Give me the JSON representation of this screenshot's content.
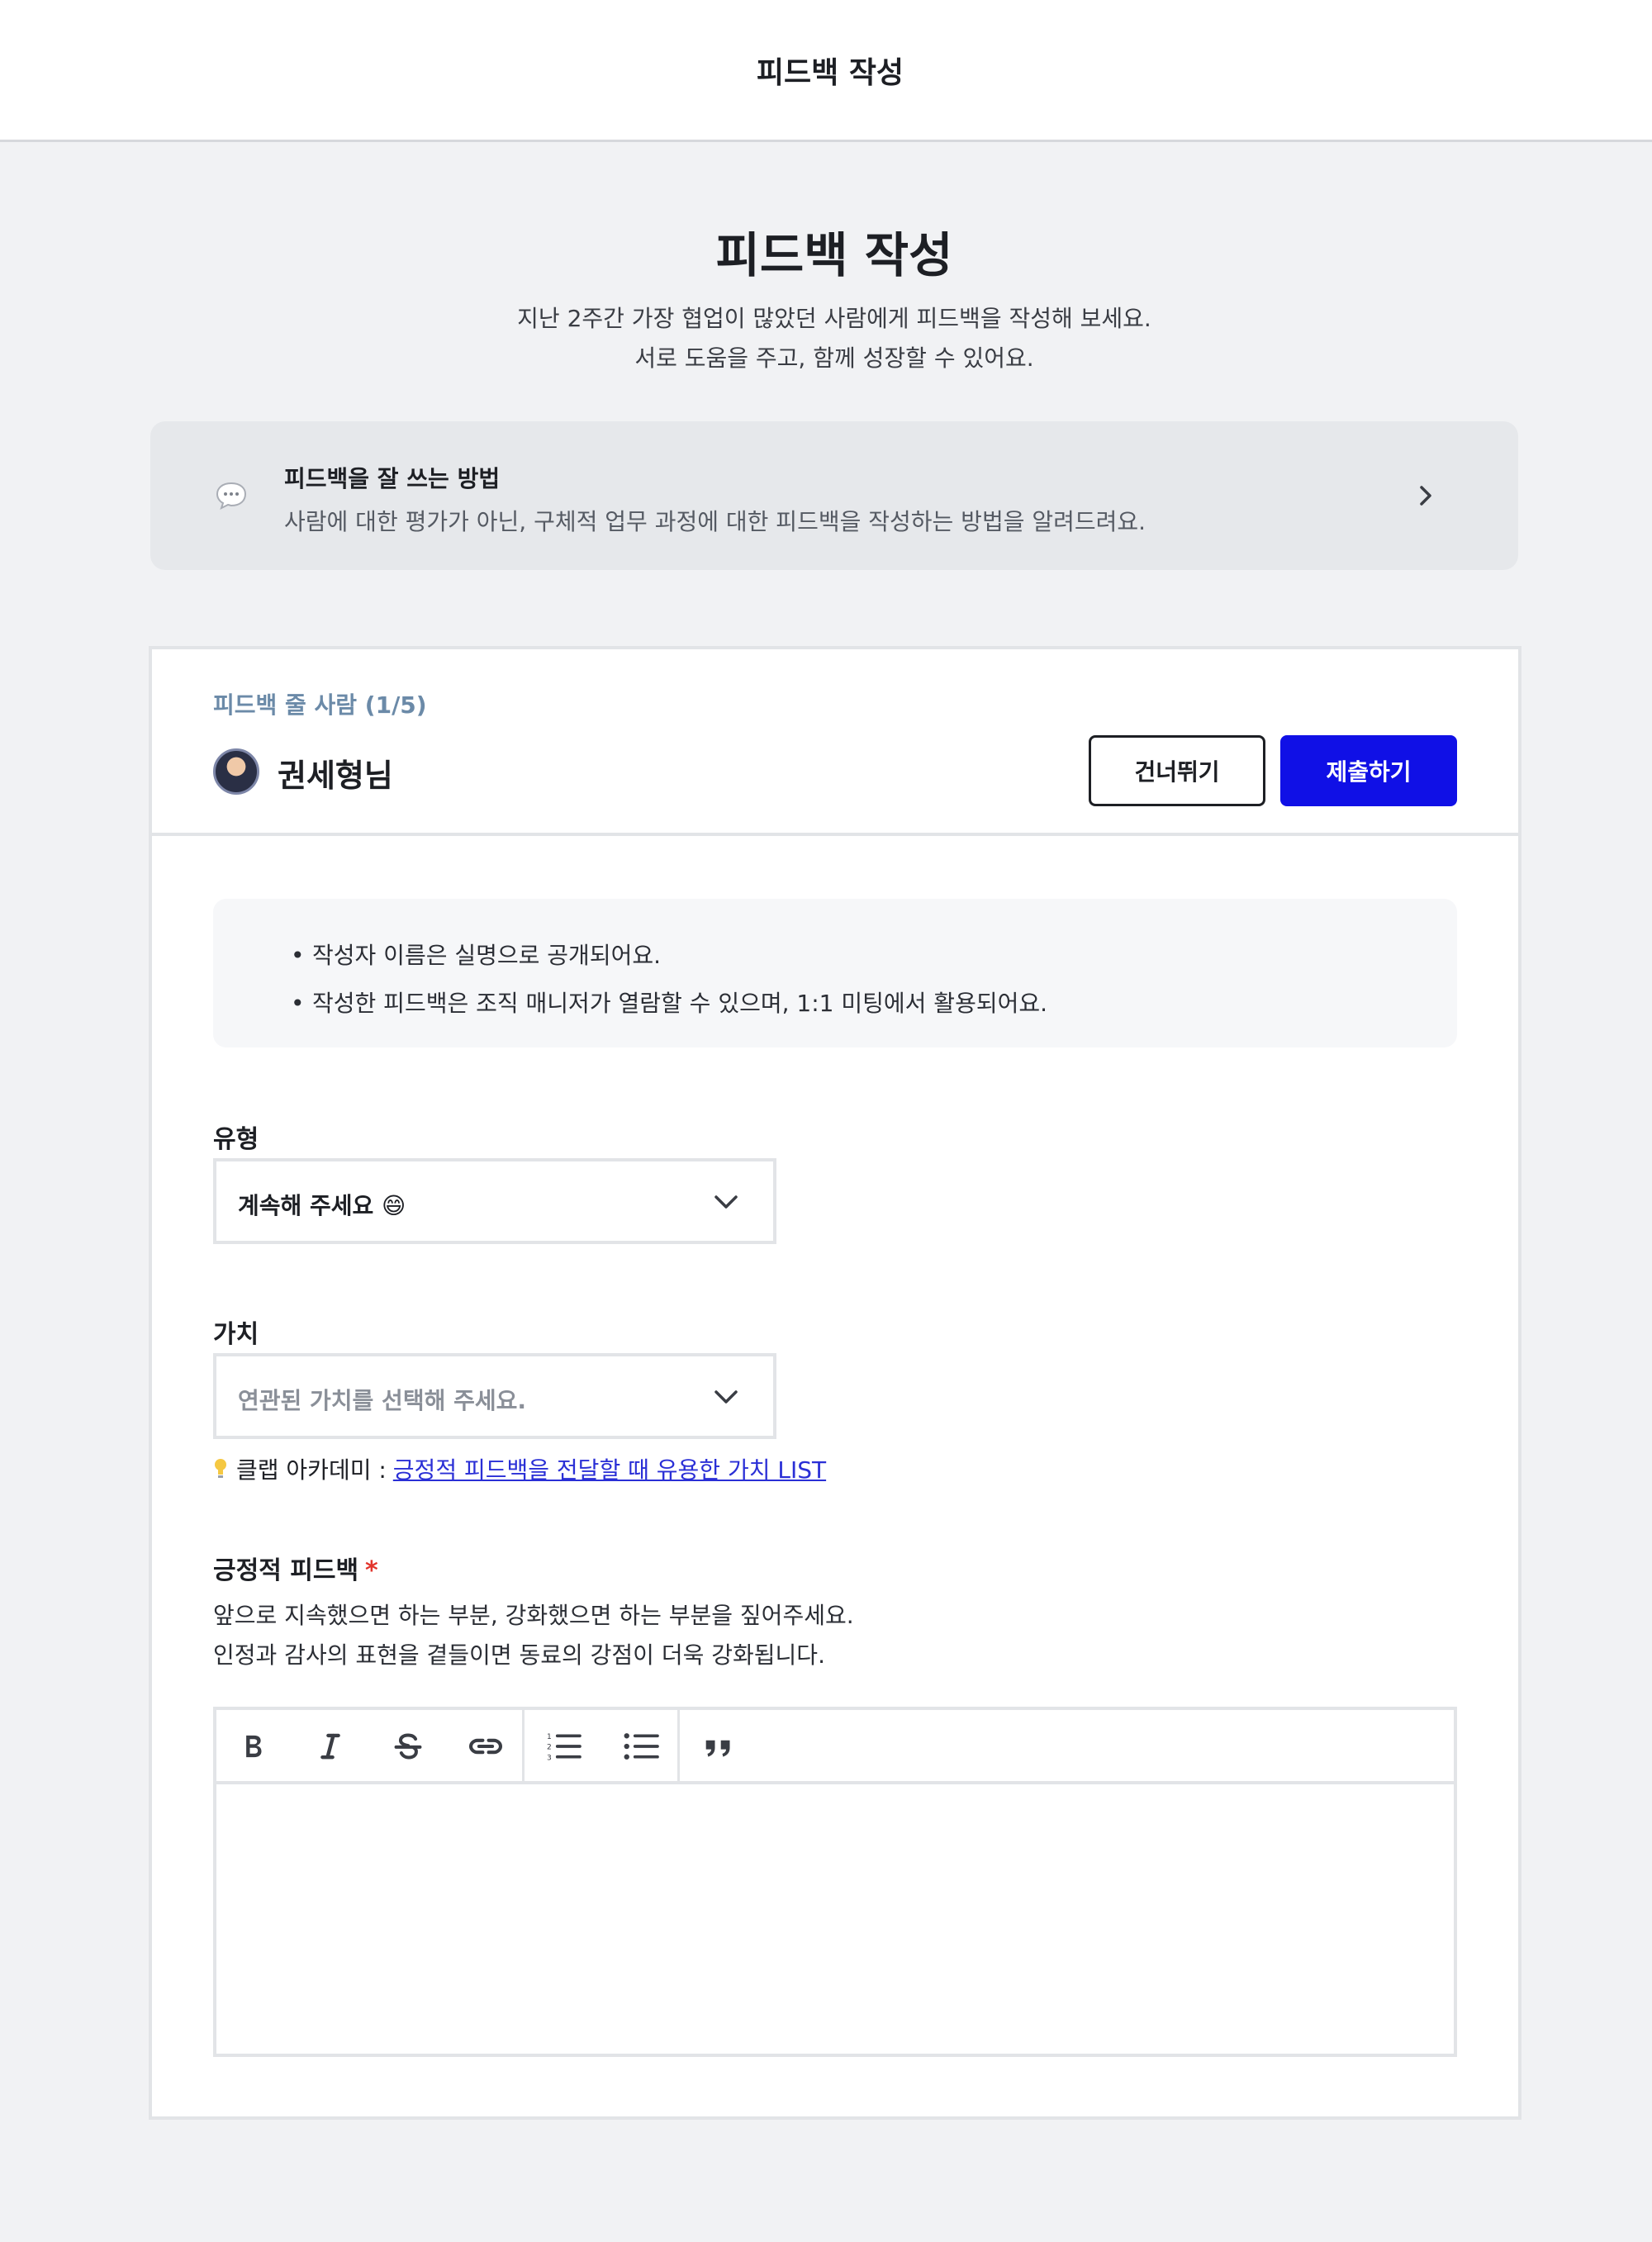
{
  "topbar": {
    "title": "피드백 작성"
  },
  "hero": {
    "title": "피드백 작성",
    "line1": "지난 2주간 가장 협업이 많았던 사람에게 피드백을 작성해 보세요.",
    "line2": "서로 도움을 주고, 함께 성장할 수 있어요."
  },
  "guide": {
    "title": "피드백을 잘 쓰는 방법",
    "desc": "사람에 대한 평가가 아닌, 구체적 업무 과정에 대한 피드백을 작성하는 방법을 알려드려요.",
    "icon": "speech-bubble-icon"
  },
  "recipient": {
    "label": "피드백 줄 사람 (1/5)",
    "name": "권세형님"
  },
  "actions": {
    "skip_label": "건너뛰기",
    "submit_label": "제출하기"
  },
  "notice": {
    "items": [
      "작성자 이름은 실명으로 공개되어요.",
      "작성한 피드백은 조직 매니저가 열람할 수 있으며, 1:1 미팅에서 활용되어요."
    ]
  },
  "type_field": {
    "label": "유형",
    "value": "계속해 주세요 😄"
  },
  "value_field": {
    "label": "가치",
    "placeholder": "연관된 가치를 선택해 주세요."
  },
  "hint": {
    "prefix": "클랩 아카데미 :",
    "link_text": "긍정적 피드백을 전달할 때 유용한 가치 LIST"
  },
  "positive_feedback": {
    "title": "긍정적 피드백",
    "required_mark": "*",
    "desc_line1": "앞으로 지속했으면 하는 부분, 강화했으면 하는 부분을 짚어주세요.",
    "desc_line2": "인정과 감사의 표현을 곁들이면 동료의 강점이 더욱 강화됩니다."
  },
  "editor_toolbar": [
    "bold-icon",
    "italic-icon",
    "strikethrough-icon",
    "link-icon",
    "ordered-list-icon",
    "bullet-list-icon",
    "quote-icon"
  ],
  "colors": {
    "primary": "#1010e6",
    "link": "#2a2fd6",
    "required": "#e2352c",
    "recipient_label": "#6b8aa8"
  }
}
